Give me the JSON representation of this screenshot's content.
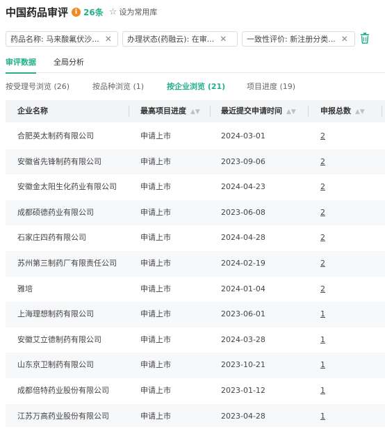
{
  "header": {
    "title": "中国药品审评",
    "count": "26条",
    "favorite_label": "设为常用库"
  },
  "filters": [
    {
      "label": "药品名称: 马来酸氟伏沙..."
    },
    {
      "label": "办理状态(药融云): 在审..."
    },
    {
      "label": "一致性评价: 新注册分类..."
    }
  ],
  "main_tabs": [
    {
      "label": "审评数据",
      "active": true
    },
    {
      "label": "全局分析",
      "active": false
    }
  ],
  "sub_tabs": [
    {
      "label": "按受理号浏览 (26)"
    },
    {
      "label": "按品种浏览 (1)"
    },
    {
      "label": "按企业浏览 (21)"
    },
    {
      "label": "项目进度 (19)"
    }
  ],
  "table": {
    "columns": [
      "企业名称",
      "最高项目进度",
      "最近提交申请时间",
      "申报总数"
    ],
    "rows": [
      {
        "company": "合肥英太制药有限公司",
        "progress": "申请上市",
        "date": "2024-03-01",
        "total": "2"
      },
      {
        "company": "安徽省先锋制药有限公司",
        "progress": "申请上市",
        "date": "2023-09-06",
        "total": "2"
      },
      {
        "company": "安徽金太阳生化药业有限公司",
        "progress": "申请上市",
        "date": "2024-04-23",
        "total": "2"
      },
      {
        "company": "成都硕德药业有限公司",
        "progress": "申请上市",
        "date": "2023-06-08",
        "total": "2"
      },
      {
        "company": "石家庄四药有限公司",
        "progress": "申请上市",
        "date": "2024-04-28",
        "total": "2"
      },
      {
        "company": "苏州第三制药厂有限责任公司",
        "progress": "申请上市",
        "date": "2024-02-19",
        "total": "2"
      },
      {
        "company": "雅培",
        "progress": "申请上市",
        "date": "2024-01-04",
        "total": "2"
      },
      {
        "company": "上海理想制药有限公司",
        "progress": "申请上市",
        "date": "2023-06-01",
        "total": "1"
      },
      {
        "company": "安徽艾立德制药有限公司",
        "progress": "申请上市",
        "date": "2024-03-28",
        "total": "1"
      },
      {
        "company": "山东京卫制药有限公司",
        "progress": "申请上市",
        "date": "2023-10-21",
        "total": "1"
      },
      {
        "company": "成都倍特药业股份有限公司",
        "progress": "申请上市",
        "date": "2023-01-12",
        "total": "1"
      },
      {
        "company": "江苏万高药业股份有限公司",
        "progress": "申请上市",
        "date": "2023-04-28",
        "total": "1"
      }
    ]
  }
}
